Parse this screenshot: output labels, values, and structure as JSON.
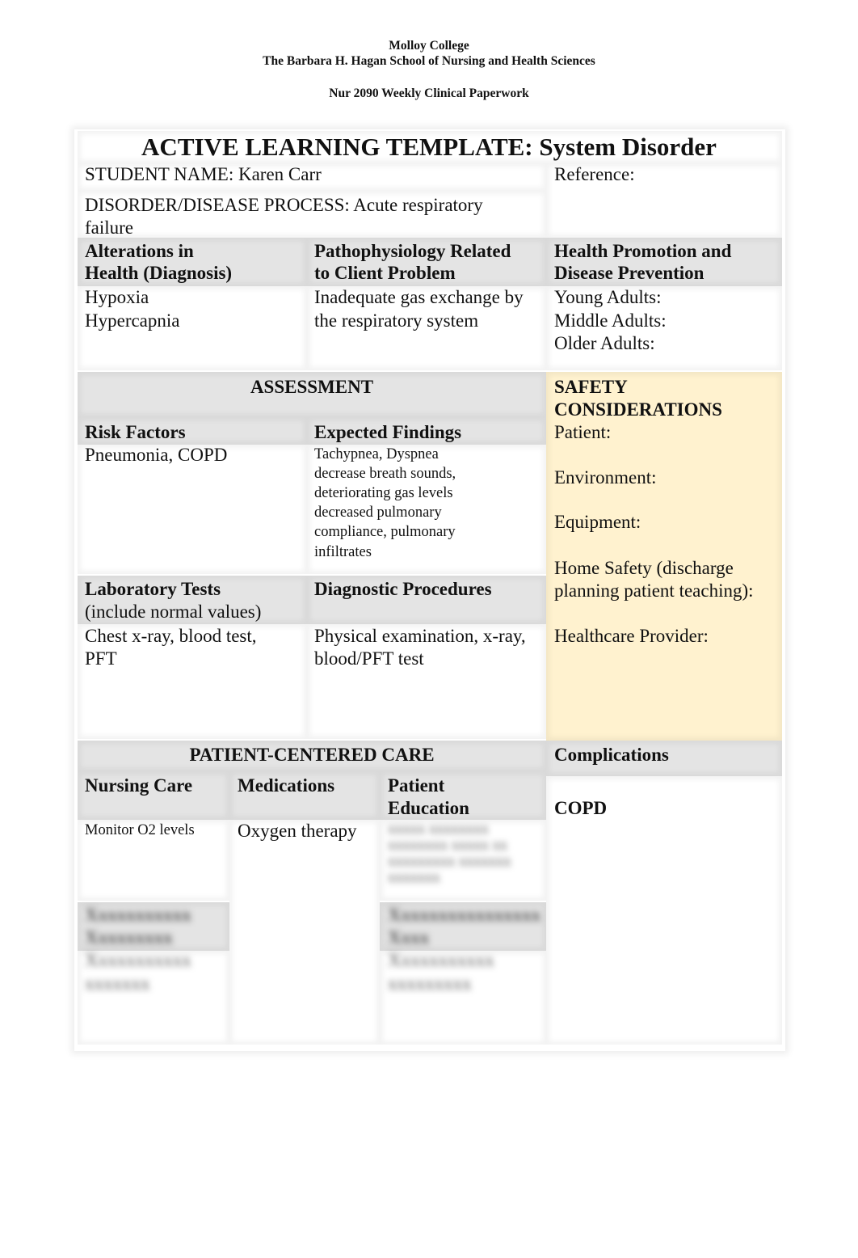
{
  "header": {
    "college": "Molloy College",
    "school": "The Barbara H. Hagan School of Nursing and Health Sciences",
    "course": "Nur 2090 Weekly Clinical Paperwork"
  },
  "template": {
    "title": "ACTIVE LEARNING TEMPLATE: System Disorder",
    "student_name": "STUDENT NAME: Karen Carr",
    "disorder_line1": "DISORDER/DISEASE PROCESS: Acute respiratory",
    "disorder_line2": "failure",
    "reference": "Reference:"
  },
  "row1": {
    "alterations_h1": "Alterations in",
    "alterations_h2": "Health (Diagnosis)",
    "alterations_items": [
      "Hypoxia",
      "Hypercapnia"
    ],
    "patho_h1": "Pathophysiology Related",
    "patho_h2": "to Client Problem",
    "patho_lines": [
      "Inadequate gas exchange by",
      "the respiratory system"
    ],
    "health_h1": "Health Promotion and",
    "health_h2": "Disease Prevention",
    "health_items": [
      "Young Adults:",
      "Middle Adults:",
      "Older Adults:"
    ]
  },
  "assessment": {
    "title": "ASSESSMENT",
    "risk_factors_h": "Risk Factors",
    "risk_factors": "Pneumonia, COPD",
    "expected_findings_h": "Expected Findings",
    "expected_findings": [
      "Tachypnea, Dyspnea",
      "decrease breath sounds,",
      "deteriorating gas levels",
      "decreased pulmonary",
      "compliance, pulmonary",
      "infiltrates"
    ],
    "lab_tests_h": "Laboratory Tests",
    "lab_tests_sub": "(include normal values)",
    "lab_tests": [
      "Chest x-ray, blood test,",
      "PFT"
    ],
    "diag_h": "Diagnostic Procedures",
    "diag": [
      "Physical examination, x-ray,",
      "blood/PFT test"
    ]
  },
  "safety": {
    "title1": "SAFETY",
    "title2": "CONSIDERATIONS",
    "patient": "Patient:",
    "environment": "Environment:",
    "equipment": "Equipment:",
    "home_safety1": "Home Safety (discharge",
    "home_safety2": "planning patient teaching):",
    "provider": "Healthcare Provider:"
  },
  "care": {
    "title": "PATIENT-CENTERED CARE",
    "nursing_h": "Nursing Care",
    "nursing": "Monitor O2 levels",
    "medications_h": "Medications",
    "medications": "Oxygen therapy",
    "education_h1": "Patient",
    "education_h2": "Education",
    "education_blurred": [
      "xxxxx xxxxxxxx",
      "xxxxxxxx xxxxx xx",
      "xxxxxxxxx xxxxxxx",
      "xxxxxxx"
    ],
    "therapeutic_blurred_h": [
      "Xxxxxxxxxxx",
      "Xxxxxxxxx"
    ],
    "therapeutic_blurred": [
      "Xxxxxxxxxxx",
      "xxxxxxx"
    ],
    "interprof_blurred_h": [
      "Xxxxxxxxxxxxxxxx",
      "Xxxx"
    ],
    "interprof_blurred": [
      "Xxxxxxxxxxx",
      "xxxxxxxxx"
    ]
  },
  "complications": {
    "title": "Complications",
    "value": "COPD"
  }
}
